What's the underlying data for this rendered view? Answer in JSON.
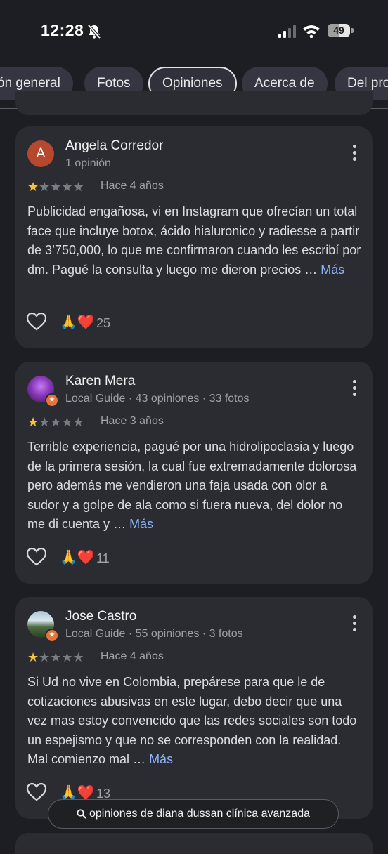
{
  "status_bar": {
    "time": "12:28",
    "battery": "49",
    "battery_level": 0.49
  },
  "tabs": [
    {
      "label": "ón general"
    },
    {
      "label": "Fotos"
    },
    {
      "label": "Opiniones"
    },
    {
      "label": "Acerca de"
    },
    {
      "label": "Del pro"
    }
  ],
  "active_tab": "Opiniones",
  "reviews": [
    {
      "avatar_letter": "A",
      "name": "Angela Corredor",
      "meta": "1 opinión",
      "rating": 1,
      "date": "Hace 4 años",
      "text": "Publicidad engañosa, vi en Instagram que ofrecían un total face que incluye botox, ácido hialuronico y radiesse a partir de 3’750,000, lo que me confirmaron cuando les escribí por dm. Pagué la consulta y luego me dieron precios …",
      "more": "Más",
      "reactions": "🙏❤️",
      "count": "25"
    },
    {
      "name": "Karen Mera",
      "meta": "Local Guide · 43 opiniones · 33 fotos",
      "rating": 1,
      "date": "Hace 3 años",
      "text": "Terrible experiencia, pagué por una hidrolipoclasia y luego de la primera sesión, la cual fue extremadamente dolorosa pero además me vendieron una faja usada con olor a sudor y a golpe de ala como si fuera nueva, del dolor no me di cuenta y …",
      "more": "Más",
      "reactions": "🙏❤️",
      "count": "11"
    },
    {
      "name": "Jose Castro",
      "meta": "Local Guide · 55 opiniones · 3 fotos",
      "rating": 1,
      "date": "Hace 4 años",
      "text": "Si Ud no vive en Colombia, prepárese para que le de cotizaciones abusivas en este lugar, debo decir que una vez mas estoy convencido que las redes sociales son todo un espejismo y que no se corresponden con la realidad. Mal comienzo mal …",
      "more": "Más",
      "reactions": "🙏❤️",
      "count": "13"
    }
  ],
  "search_pill": {
    "text": "opiniones de diana dussan clínica avanzada"
  }
}
